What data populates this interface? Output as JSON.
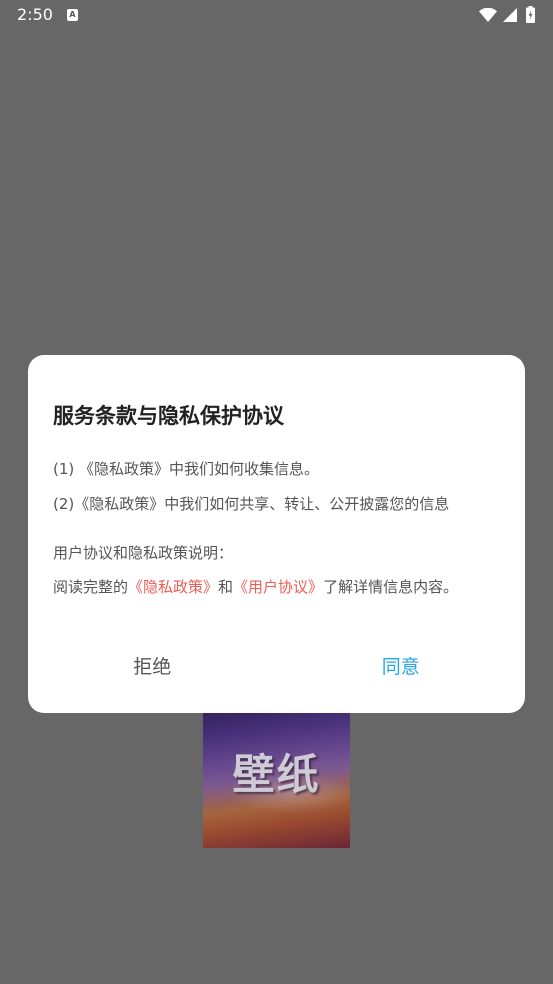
{
  "status_bar": {
    "time": "2:50",
    "notification_icon_letter": "A",
    "icons": [
      "notification-a-icon",
      "wifi-icon",
      "signal-icon",
      "battery-icon"
    ]
  },
  "background": {
    "wallpaper_text": "壁纸"
  },
  "dialog": {
    "title": "服务条款与隐私保护协议",
    "line1": "(1) 《隐私政策》中我们如何收集信息。",
    "line2": "(2)《隐私政策》中我们如何共享、转让、公开披露您的信息",
    "section_label": "用户协议和隐私政策说明：",
    "read_prefix": "阅读完整的",
    "privacy_link": "《隐私政策》",
    "read_and": "和",
    "user_agreement_link": "《用户协议》",
    "read_suffix": "了解详情信息内容。",
    "reject_label": "拒绝",
    "agree_label": "同意"
  },
  "colors": {
    "overlay_background": "#676767",
    "dialog_background": "#ffffff",
    "title_text": "#222222",
    "body_text": "#555555",
    "link": "#ee5c55",
    "reject_button": "#555555",
    "agree_button": "#26a6e6"
  }
}
